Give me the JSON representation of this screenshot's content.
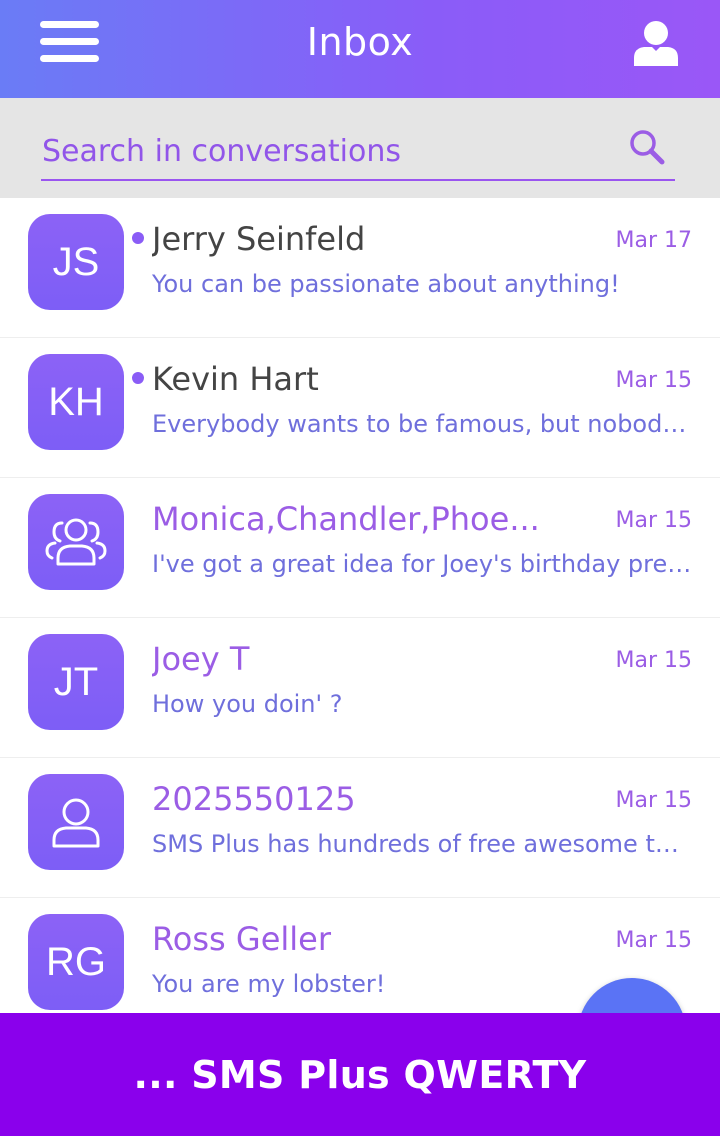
{
  "header": {
    "title": "Inbox",
    "menu_icon": "hamburger-menu-icon",
    "profile_icon": "user-profile-icon"
  },
  "search": {
    "placeholder": "Search in conversations",
    "icon": "search-icon"
  },
  "conversations": [
    {
      "avatar_text": "JS",
      "avatar_icon": "",
      "name": "Jerry Seinfeld",
      "date": "Mar 17",
      "preview": "You can be passionate about anything!",
      "unread": true
    },
    {
      "avatar_text": "KH",
      "avatar_icon": "",
      "name": "Kevin Hart",
      "date": "Mar 15",
      "preview": "Everybody wants to be famous, but nobody...",
      "unread": true
    },
    {
      "avatar_text": "",
      "avatar_icon": "group-icon",
      "name": "Monica,Chandler,Phoe...",
      "date": "Mar 15",
      "preview": "I've got a great idea for Joey's birthday pres...",
      "unread": false
    },
    {
      "avatar_text": "JT",
      "avatar_icon": "",
      "name": "Joey T",
      "date": "Mar 15",
      "preview": "How you doin' ?",
      "unread": false
    },
    {
      "avatar_text": "",
      "avatar_icon": "person-icon",
      "name": "2025550125",
      "date": "Mar 15",
      "preview": "SMS Plus has hundreds of free awesome th...",
      "unread": false
    },
    {
      "avatar_text": "RG",
      "avatar_icon": "",
      "name": "Ross Geller",
      "date": "Mar 15",
      "preview": "You are my lobster!",
      "unread": false
    }
  ],
  "banner": {
    "text": "... SMS Plus QWERTY"
  },
  "colors": {
    "accent": "#8a5cf6",
    "header_start": "#6a7cf6",
    "header_end": "#9a57f7",
    "banner": "#8a00ec",
    "fab": "#5a73f5"
  }
}
